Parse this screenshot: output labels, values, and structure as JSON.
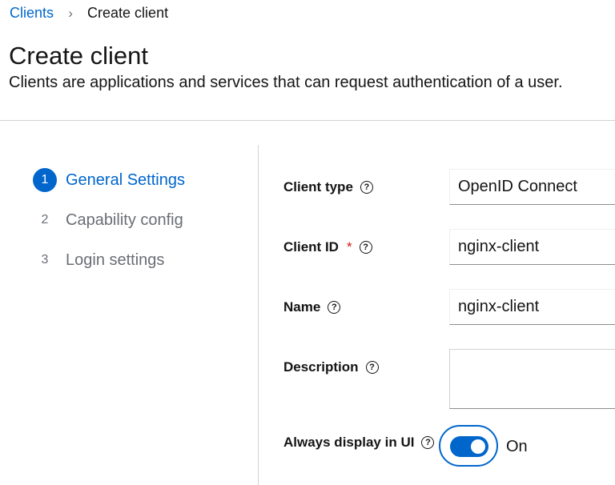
{
  "breadcrumb": {
    "parent": "Clients",
    "separator": "›",
    "current": "Create client"
  },
  "page": {
    "title": "Create client",
    "description": "Clients are applications and services that can request authentication of a user."
  },
  "steps": [
    {
      "number": "1",
      "label": "General Settings",
      "active": true
    },
    {
      "number": "2",
      "label": "Capability config",
      "active": false
    },
    {
      "number": "3",
      "label": "Login settings",
      "active": false
    }
  ],
  "form": {
    "client_type": {
      "label": "Client type",
      "value": "OpenID Connect"
    },
    "client_id": {
      "label": "Client ID",
      "required_mark": "*",
      "value": "nginx-client"
    },
    "name": {
      "label": "Name",
      "value": "nginx-client"
    },
    "description": {
      "label": "Description",
      "value": ""
    },
    "always_display": {
      "label": "Always display in UI",
      "state_text": "On",
      "checked": true
    }
  },
  "help_icon": "?",
  "colors": {
    "accent": "#0066cc",
    "required": "#c9190b",
    "muted": "#6a6e73"
  }
}
